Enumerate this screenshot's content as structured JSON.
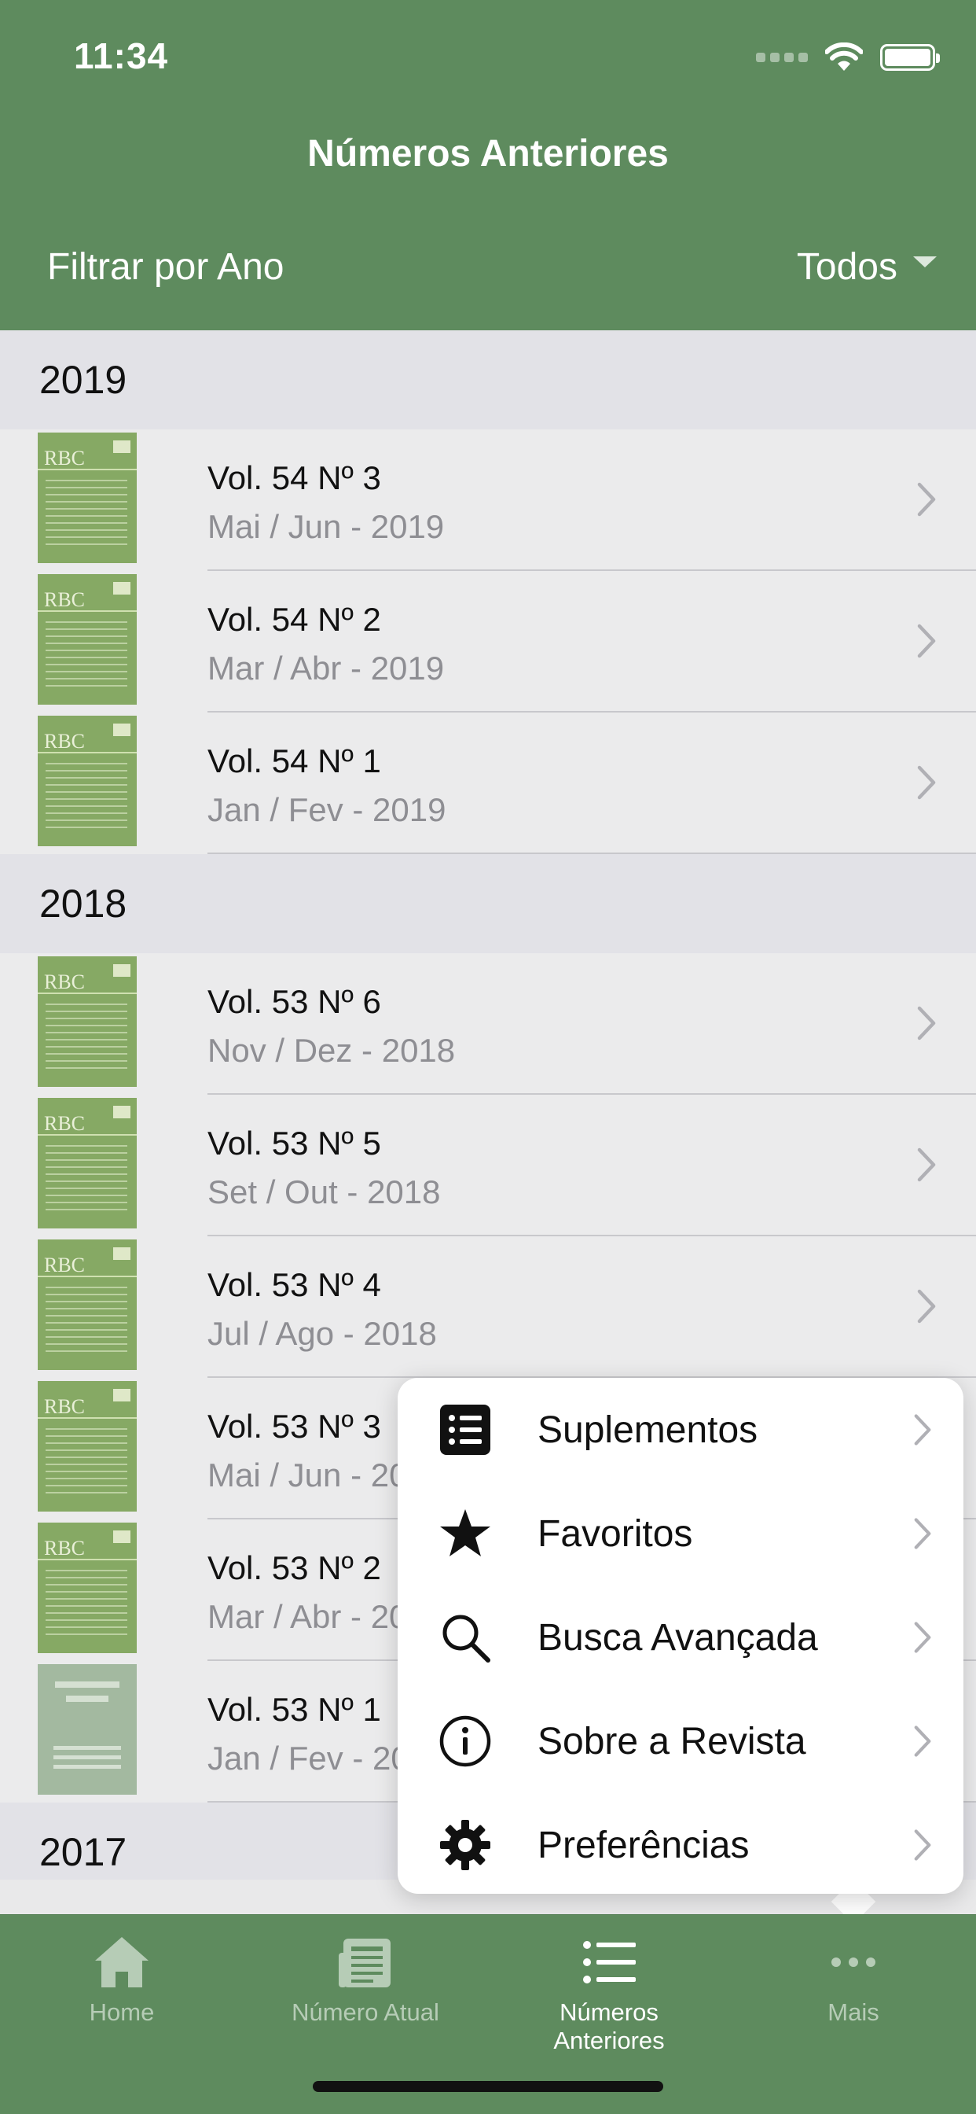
{
  "status_bar": {
    "time": "11:34"
  },
  "nav": {
    "title": "Números Anteriores"
  },
  "filter": {
    "label": "Filtrar por Ano",
    "value": "Todos"
  },
  "sections": [
    {
      "year": "2019",
      "items": [
        {
          "title": "Vol. 54 Nº 3",
          "subtitle": "Mai / Jun - 2019",
          "cover": "rbc"
        },
        {
          "title": "Vol. 54 Nº 2",
          "subtitle": "Mar / Abr - 2019",
          "cover": "rbc"
        },
        {
          "title": "Vol. 54 Nº 1",
          "subtitle": "Jan / Fev - 2019",
          "cover": "rbc"
        }
      ]
    },
    {
      "year": "2018",
      "items": [
        {
          "title": "Vol. 53 Nº 6",
          "subtitle": "Nov / Dez - 2018",
          "cover": "rbc"
        },
        {
          "title": "Vol. 53 Nº 5",
          "subtitle": "Set / Out - 2018",
          "cover": "rbc"
        },
        {
          "title": "Vol. 53 Nº 4",
          "subtitle": "Jul / Ago - 2018",
          "cover": "rbc"
        },
        {
          "title": "Vol. 53 Nº 3",
          "subtitle": "Mai / Jun - 2018",
          "cover": "rbc"
        },
        {
          "title": "Vol. 53 Nº 2",
          "subtitle": "Mar / Abr - 2018",
          "cover": "rbc"
        },
        {
          "title": "Vol. 53 Nº 1",
          "subtitle": "Jan / Fev - 2018",
          "cover": "placeholder"
        }
      ]
    },
    {
      "year": "2017",
      "items": []
    }
  ],
  "cover_text": "RBC",
  "menu": {
    "items": [
      {
        "label": "Suplementos",
        "icon": "list-icon"
      },
      {
        "label": "Favoritos",
        "icon": "star-icon"
      },
      {
        "label": "Busca Avançada",
        "icon": "search-icon"
      },
      {
        "label": "Sobre a Revista",
        "icon": "info-icon"
      },
      {
        "label": "Preferências",
        "icon": "gear-icon"
      }
    ]
  },
  "tabbar": {
    "tabs": [
      {
        "label": "Home",
        "icon": "home-icon",
        "active": false
      },
      {
        "label": "Número Atual",
        "icon": "newspaper-icon",
        "active": false
      },
      {
        "label": "Números Anteriores",
        "icon": "list-icon",
        "active": true
      },
      {
        "label": "Mais",
        "icon": "more-icon",
        "active": false
      }
    ]
  },
  "colors": {
    "brand": "#5e8b5e",
    "cover": "#86a964",
    "secondary_text": "#8e8e93"
  }
}
